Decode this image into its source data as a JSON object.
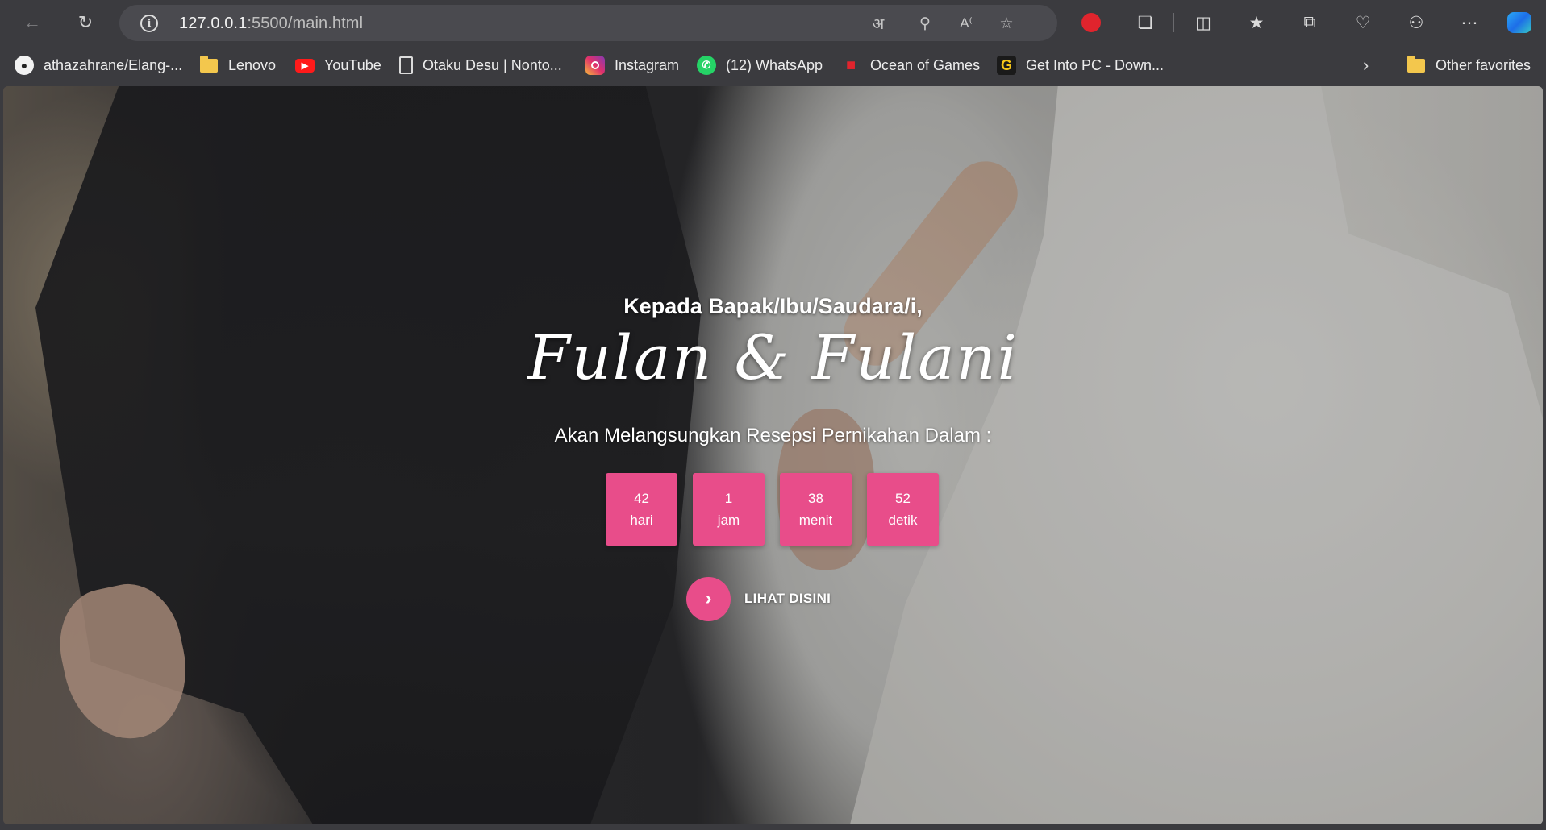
{
  "browser": {
    "url_host": "127.0.0.1",
    "url_rest": ":5500/main.html",
    "icons": {
      "back": "back-arrow-icon",
      "refresh": "refresh-icon",
      "info": "site-info-icon",
      "translate": "translate-icon",
      "zoom": "zoom-out-icon",
      "read_aloud": "read-aloud-icon",
      "favorite": "favorite-star-icon",
      "extension_red": "extension-red-icon",
      "extensions": "extensions-puzzle-icon",
      "split_screen": "split-screen-icon",
      "favorites": "favorites-icon",
      "collections": "collections-icon",
      "performance": "browser-essentials-icon",
      "share": "share-icon",
      "more": "more-icon",
      "copilot": "copilot-icon"
    }
  },
  "bookmarks": [
    {
      "label": "athazahrane/Elang-...",
      "icon": "github-icon"
    },
    {
      "label": "Lenovo",
      "icon": "folder-icon"
    },
    {
      "label": "YouTube",
      "icon": "youtube-icon"
    },
    {
      "label": "Otaku Desu | Nonto...",
      "icon": "page-icon"
    },
    {
      "label": "Instagram",
      "icon": "instagram-icon"
    },
    {
      "label": "(12) WhatsApp",
      "icon": "whatsapp-icon"
    },
    {
      "label": "Ocean of Games",
      "icon": "gamepad-icon"
    },
    {
      "label": "Get Into PC - Down...",
      "icon": "getintopc-icon"
    }
  ],
  "bookmarks_other": "Other favorites",
  "hero": {
    "greeting": "Kepada Bapak/Ibu/Saudara/i,",
    "couple": "Fulan & Fulani",
    "subtitle": "Akan Melangsungkan Resepsi Pernikahan Dalam :",
    "countdown": [
      {
        "value": "42",
        "unit": "hari"
      },
      {
        "value": "1",
        "unit": "jam"
      },
      {
        "value": "38",
        "unit": "menit"
      },
      {
        "value": "52",
        "unit": "detik"
      }
    ],
    "cta_label": "LIHAT DISINI",
    "accent_color": "#e84d8a"
  }
}
